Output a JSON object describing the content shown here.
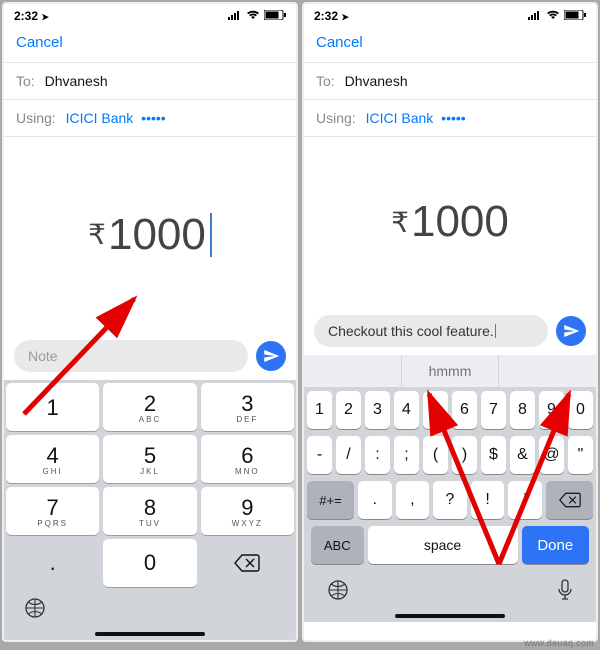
{
  "statusbar": {
    "time": "2:32",
    "location_glyph": "➤"
  },
  "nav": {
    "cancel": "Cancel"
  },
  "to": {
    "label": "To:",
    "value": "Dhvanesh"
  },
  "using": {
    "label": "Using:",
    "bank": "ICICI Bank",
    "masked": "•••••"
  },
  "amount": {
    "currency": "₹",
    "value": "1000"
  },
  "left": {
    "note_placeholder": "Note"
  },
  "right": {
    "note_value": "Checkout this cool feature.",
    "suggestions": [
      "",
      "hmmm",
      ""
    ]
  },
  "numpad": {
    "r1": [
      {
        "n": "1",
        "s": ""
      },
      {
        "n": "2",
        "s": "ABC"
      },
      {
        "n": "3",
        "s": "DEF"
      }
    ],
    "r2": [
      {
        "n": "4",
        "s": "GHI"
      },
      {
        "n": "5",
        "s": "JKL"
      },
      {
        "n": "6",
        "s": "MNO"
      }
    ],
    "r3": [
      {
        "n": "7",
        "s": "PQRS"
      },
      {
        "n": "8",
        "s": "TUV"
      },
      {
        "n": "9",
        "s": "WXYZ"
      }
    ],
    "dot": ".",
    "zero": "0"
  },
  "qkbd": {
    "row1": [
      "1",
      "2",
      "3",
      "4",
      "5",
      "6",
      "7",
      "8",
      "9",
      "0"
    ],
    "row2": [
      "-",
      "/",
      ":",
      ";",
      "(",
      ")",
      "$",
      "&",
      "@",
      "\""
    ],
    "row3_shift": "#+=",
    "row3": [
      ".",
      ",",
      "?",
      "!",
      "'"
    ],
    "row4_abc": "ABC",
    "row4_space": "space",
    "row4_done": "Done"
  },
  "watermark": "www.deuaq.com"
}
